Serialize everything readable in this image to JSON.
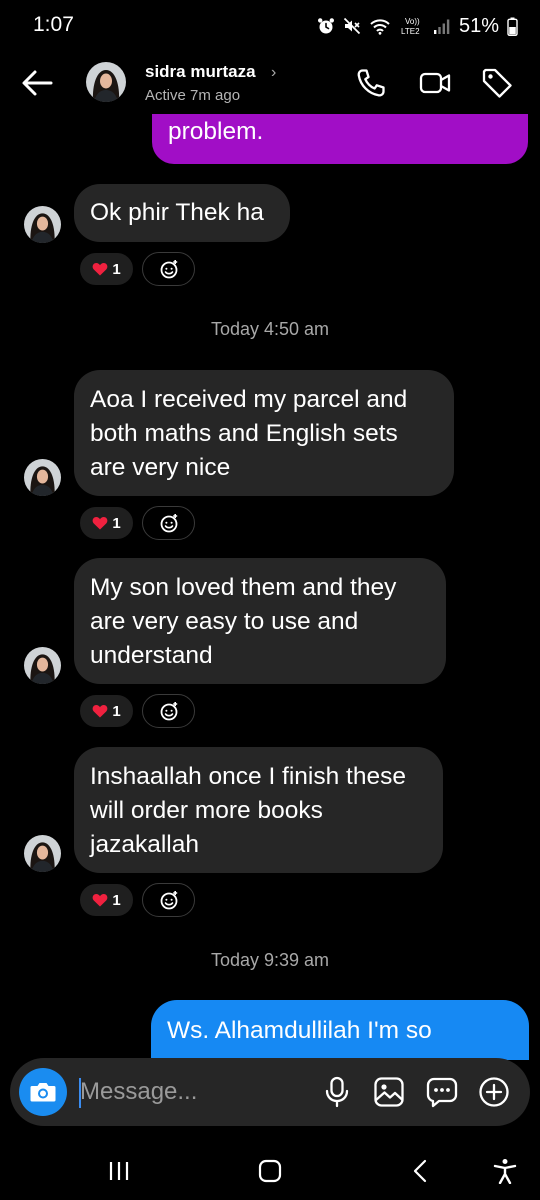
{
  "status_bar": {
    "time": "1:07",
    "network_label_1": "Vo))",
    "network_label_2": "LTE2",
    "battery": "51%"
  },
  "header": {
    "contact_name": "sidra murtaza",
    "active_status": "Active 7m ago",
    "icons": [
      "back-arrow-icon",
      "phone-icon",
      "video-call-icon",
      "tag-icon"
    ]
  },
  "conversation": {
    "partial_outgoing_top": "problem.",
    "timestamps": [
      "Today 4:50 am",
      "Today 9:39 am"
    ],
    "incoming": [
      {
        "text": "Ok phir Thek ha",
        "reaction_emoji": "heart",
        "reaction_count": "1"
      },
      {
        "text": "Aoa I received my parcel and both maths and English sets are very nice",
        "reaction_emoji": "heart",
        "reaction_count": "1"
      },
      {
        "text": "My son loved them and they are very easy to use and understand",
        "reaction_emoji": "heart",
        "reaction_count": "1"
      },
      {
        "text": "Inshaallah once I finish these will order more books jazakallah",
        "reaction_emoji": "heart",
        "reaction_count": "1"
      }
    ],
    "partial_outgoing_bottom": "Ws. Alhamdullilah I'm so"
  },
  "composer": {
    "placeholder": "Message...",
    "icons": [
      "camera-icon",
      "microphone-icon",
      "gallery-icon",
      "sticker-icon",
      "add-icon"
    ]
  },
  "colors": {
    "background": "#000000",
    "incoming_bubble": "#262626",
    "outgoing_purple": "#a10ec6",
    "outgoing_blue": "#1689f3",
    "camera_button": "#1a8cf0"
  }
}
